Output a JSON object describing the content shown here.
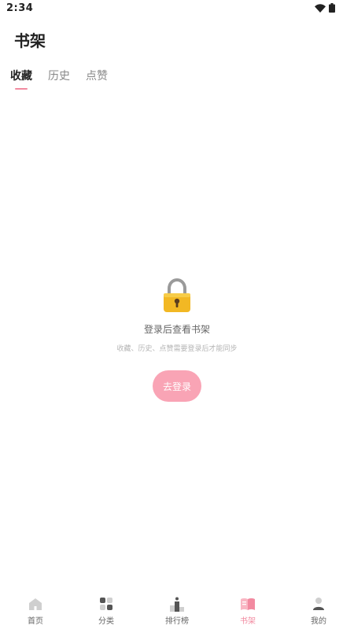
{
  "status_bar": {
    "time": "2:34"
  },
  "header": {
    "title": "书架"
  },
  "tabs": [
    {
      "label": "收藏",
      "active": true
    },
    {
      "label": "历史",
      "active": false
    },
    {
      "label": "点赞",
      "active": false
    }
  ],
  "empty_state": {
    "icon": "lock-icon",
    "title": "登录后查看书架",
    "subtitle": "收藏、历史、点赞需要登录后才能同步",
    "button_label": "去登录"
  },
  "bottom_nav": [
    {
      "label": "首页",
      "icon": "home-icon",
      "active": false
    },
    {
      "label": "分类",
      "icon": "category-icon",
      "active": false
    },
    {
      "label": "排行榜",
      "icon": "ranking-icon",
      "active": false
    },
    {
      "label": "书架",
      "icon": "bookshelf-icon",
      "active": true
    },
    {
      "label": "我的",
      "icon": "profile-icon",
      "active": false
    }
  ],
  "colors": {
    "accent": "#f28aa0",
    "button": "#f9a4b5"
  }
}
